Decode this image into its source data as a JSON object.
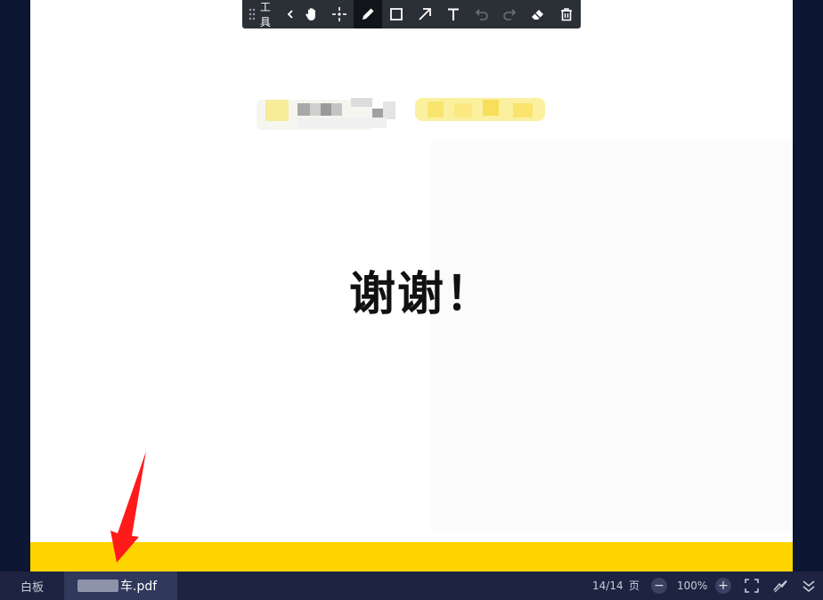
{
  "toolbar": {
    "title": "工具",
    "tools": [
      "grip-icon",
      "collapse-icon",
      "hand-icon",
      "laser-pointer-icon",
      "pen-icon",
      "rectangle-icon",
      "arrow-icon",
      "text-icon",
      "undo-icon",
      "redo-icon",
      "eraser-icon",
      "delete-icon"
    ],
    "active_tool": "pen-icon"
  },
  "slide": {
    "heading": "谢谢！"
  },
  "bottombar": {
    "whiteboard_tab": "白板",
    "file_tab_suffix": "车.pdf",
    "page_count": "14/14",
    "page_unit": "页",
    "zoom_out": "−",
    "zoom": "100%",
    "zoom_in": "+"
  },
  "colors": {
    "accent_yellow": "#fdd400",
    "toolbar_bg": "#2b2f36",
    "bottombar_bg": "#1d2340",
    "annotation_arrow": "#ff1a1a"
  }
}
